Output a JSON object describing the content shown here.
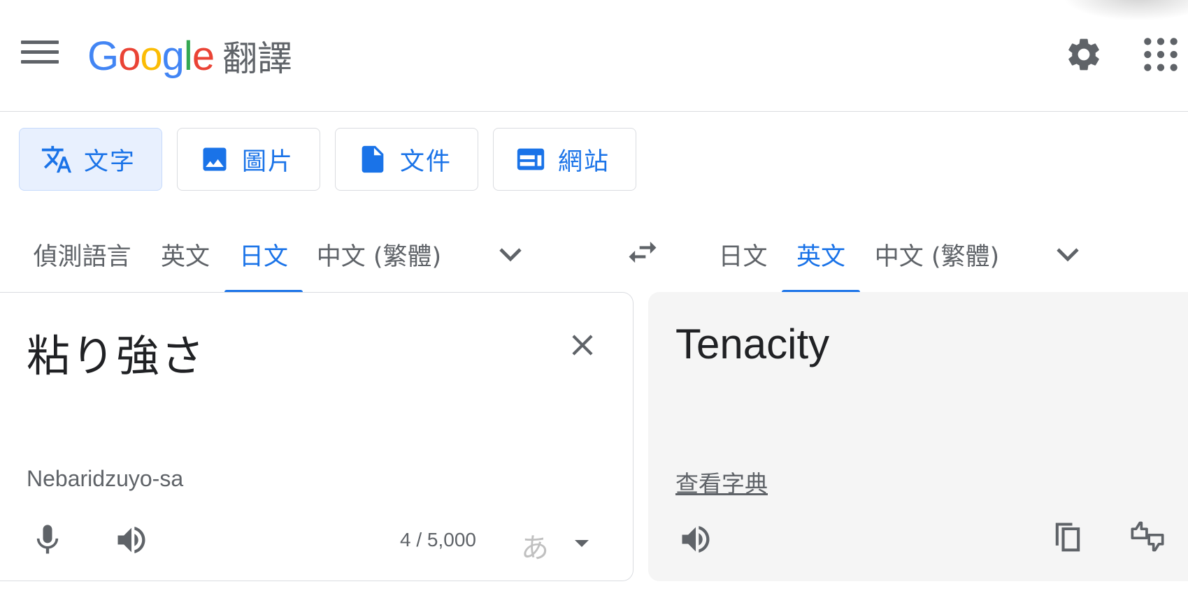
{
  "header": {
    "logo_letters": [
      {
        "char": "G",
        "color": "#4285F4"
      },
      {
        "char": "o",
        "color": "#EA4335"
      },
      {
        "char": "o",
        "color": "#FBBC05"
      },
      {
        "char": "g",
        "color": "#4285F4"
      },
      {
        "char": "l",
        "color": "#34A853"
      },
      {
        "char": "e",
        "color": "#EA4335"
      }
    ],
    "product_name": "翻譯",
    "icons": [
      "menu-icon",
      "settings-icon",
      "apps-icon"
    ]
  },
  "mode_tabs": [
    {
      "label": "文字",
      "icon": "translate-icon",
      "active": true
    },
    {
      "label": "圖片",
      "icon": "image-icon",
      "active": false
    },
    {
      "label": "文件",
      "icon": "document-icon",
      "active": false
    },
    {
      "label": "網站",
      "icon": "website-icon",
      "active": false
    }
  ],
  "source_languages": [
    {
      "label": "偵測語言",
      "active": false
    },
    {
      "label": "英文",
      "active": false
    },
    {
      "label": "日文",
      "active": true
    },
    {
      "label": "中文 (繁體)",
      "active": false
    }
  ],
  "target_languages": [
    {
      "label": "日文",
      "active": false
    },
    {
      "label": "英文",
      "active": true
    },
    {
      "label": "中文 (繁體)",
      "active": false
    }
  ],
  "source": {
    "text": "粘り強さ",
    "romanization": "Nebaridzuyo-sa",
    "char_count": "4 / 5,000",
    "ime_label": "あ"
  },
  "target": {
    "text": "Tenacity",
    "dictionary_link": "查看字典"
  },
  "colors": {
    "accent": "#1a73e8",
    "icon_gray": "#5f6368",
    "active_tab_bg": "#e8f0fe",
    "target_panel_bg": "#f5f5f5"
  }
}
